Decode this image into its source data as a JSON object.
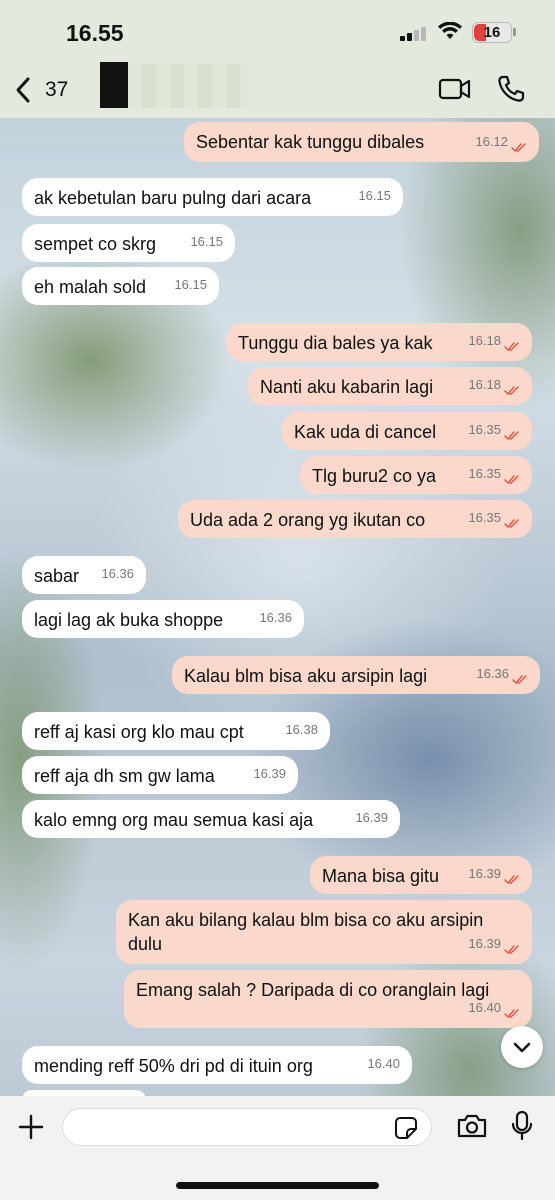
{
  "status_bar": {
    "time": "16.55",
    "battery": "16"
  },
  "header": {
    "back_count": "37"
  },
  "messages": [
    {
      "dir": "out",
      "text": "Sebentar kak tunggu dibales",
      "time": "16.12"
    },
    {
      "dir": "in",
      "text": "ak kebetulan baru pulng dari acara",
      "time": "16.15"
    },
    {
      "dir": "in",
      "text": "sempet co skrg",
      "time": "16.15"
    },
    {
      "dir": "in",
      "text": "eh malah sold",
      "time": "16.15"
    },
    {
      "dir": "out",
      "text": "Tunggu dia bales ya kak",
      "time": "16.18"
    },
    {
      "dir": "out",
      "text": "Nanti aku kabarin lagi",
      "time": "16.18"
    },
    {
      "dir": "out",
      "text": "Kak uda di cancel",
      "time": "16.35"
    },
    {
      "dir": "out",
      "text": "Tlg buru2 co ya",
      "time": "16.35"
    },
    {
      "dir": "out",
      "text": "Uda ada 2 orang yg ikutan co",
      "time": "16.35"
    },
    {
      "dir": "in",
      "text": "sabar",
      "time": "16.36"
    },
    {
      "dir": "in",
      "text": "lagi lag ak buka shoppe",
      "time": "16.36"
    },
    {
      "dir": "out",
      "text": "Kalau blm bisa aku arsipin lagi",
      "time": "16.36"
    },
    {
      "dir": "in",
      "text": "reff aj kasi org klo mau cpt",
      "time": "16.38"
    },
    {
      "dir": "in",
      "text": "reff aja dh sm gw lama",
      "time": "16.39"
    },
    {
      "dir": "in",
      "text": "kalo emng org mau semua kasi aja",
      "time": "16.39"
    },
    {
      "dir": "out",
      "text": "Mana bisa gitu",
      "time": "16.39"
    },
    {
      "dir": "out",
      "text": "Kan aku bilang kalau blm bisa co aku arsipin\ndulu",
      "time": "16.39"
    },
    {
      "dir": "out",
      "text": "Emang salah ? Daripada di co oranglain lagi",
      "time": "16.40"
    },
    {
      "dir": "in",
      "text": "mending reff 50% dri pd di ituin org",
      "time": "16.40"
    }
  ],
  "colors": {
    "incoming": "#ffffff",
    "outgoing": "#fad8cb",
    "read_ticks": "#e0533f"
  },
  "icons": [
    "back-chevron-icon",
    "video-call-icon",
    "phone-icon",
    "plus-icon",
    "sticker-icon",
    "camera-icon",
    "mic-icon",
    "chevron-down-icon",
    "read-ticks-icon"
  ]
}
